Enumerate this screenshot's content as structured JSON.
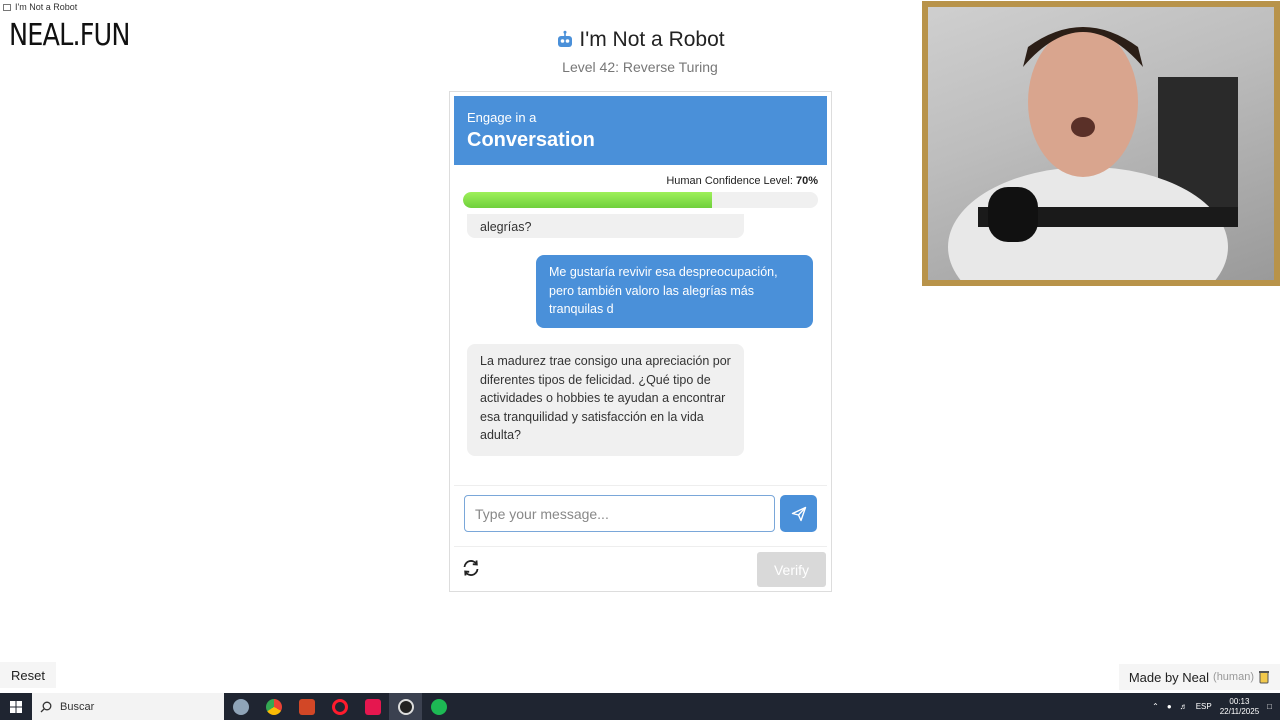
{
  "window": {
    "title": "I'm Not a Robot"
  },
  "site": {
    "logo": "NEAL.FUN"
  },
  "header": {
    "title": "I'm Not a Robot",
    "subtitle": "Level 42: Reverse Turing"
  },
  "banner": {
    "small": "Engage in a",
    "big": "Conversation"
  },
  "confidence": {
    "label": "Human Confidence Level:",
    "value_text": "70%",
    "value": 0.7
  },
  "chat": {
    "messages": [
      {
        "from": "bot",
        "text": "alegrías?"
      },
      {
        "from": "user",
        "text": "Me gustaría revivir esa despreocupación, pero también valoro las alegrías más tranquilas d"
      },
      {
        "from": "bot",
        "text": "La madurez trae consigo una apreciación por diferentes tipos de felicidad. ¿Qué tipo de actividades o hobbies te ayudan a encontrar esa tranquilidad y satisfacción en la vida adulta?"
      }
    ]
  },
  "input": {
    "placeholder": "Type your message...",
    "value": ""
  },
  "actions": {
    "verify_label": "Verify"
  },
  "footer": {
    "reset_label": "Reset",
    "made_by": "Made by Neal",
    "made_by_note": "(human)"
  },
  "taskbar": {
    "search_placeholder": "Buscar",
    "lang": "ESP",
    "time": "00:13",
    "date": "22/11/2025"
  },
  "colors": {
    "accent": "#4a90d9",
    "progress": "#7ad94a",
    "cam_frame": "#b8934a"
  },
  "icons": [
    "robot-icon",
    "send-icon",
    "refresh-icon",
    "windows-icon",
    "search-icon",
    "coffee-icon"
  ]
}
